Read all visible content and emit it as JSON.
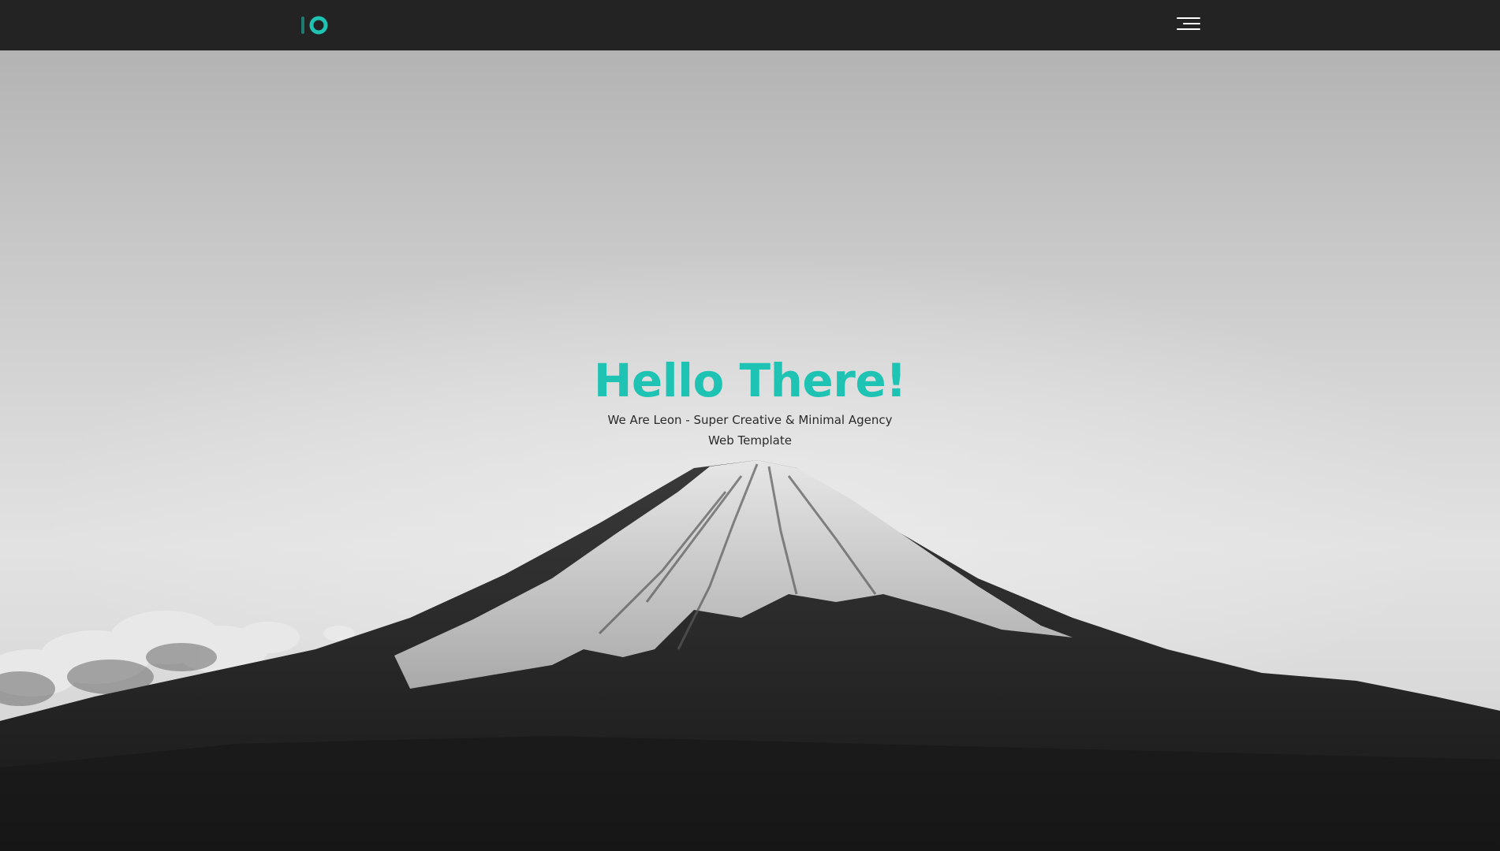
{
  "navbar": {
    "logo_icon": "brand-logo-icon",
    "menu_icon": "hamburger-menu-icon"
  },
  "hero": {
    "title": "Hello There!",
    "subtitle": "We Are Leon - Super Creative & Minimal Agency Web Template",
    "background_image": "mountain-photo"
  },
  "colors": {
    "accent": "#1ec3b4",
    "navbar_bg": "#232323",
    "subtitle_text": "#2a2a2a"
  }
}
